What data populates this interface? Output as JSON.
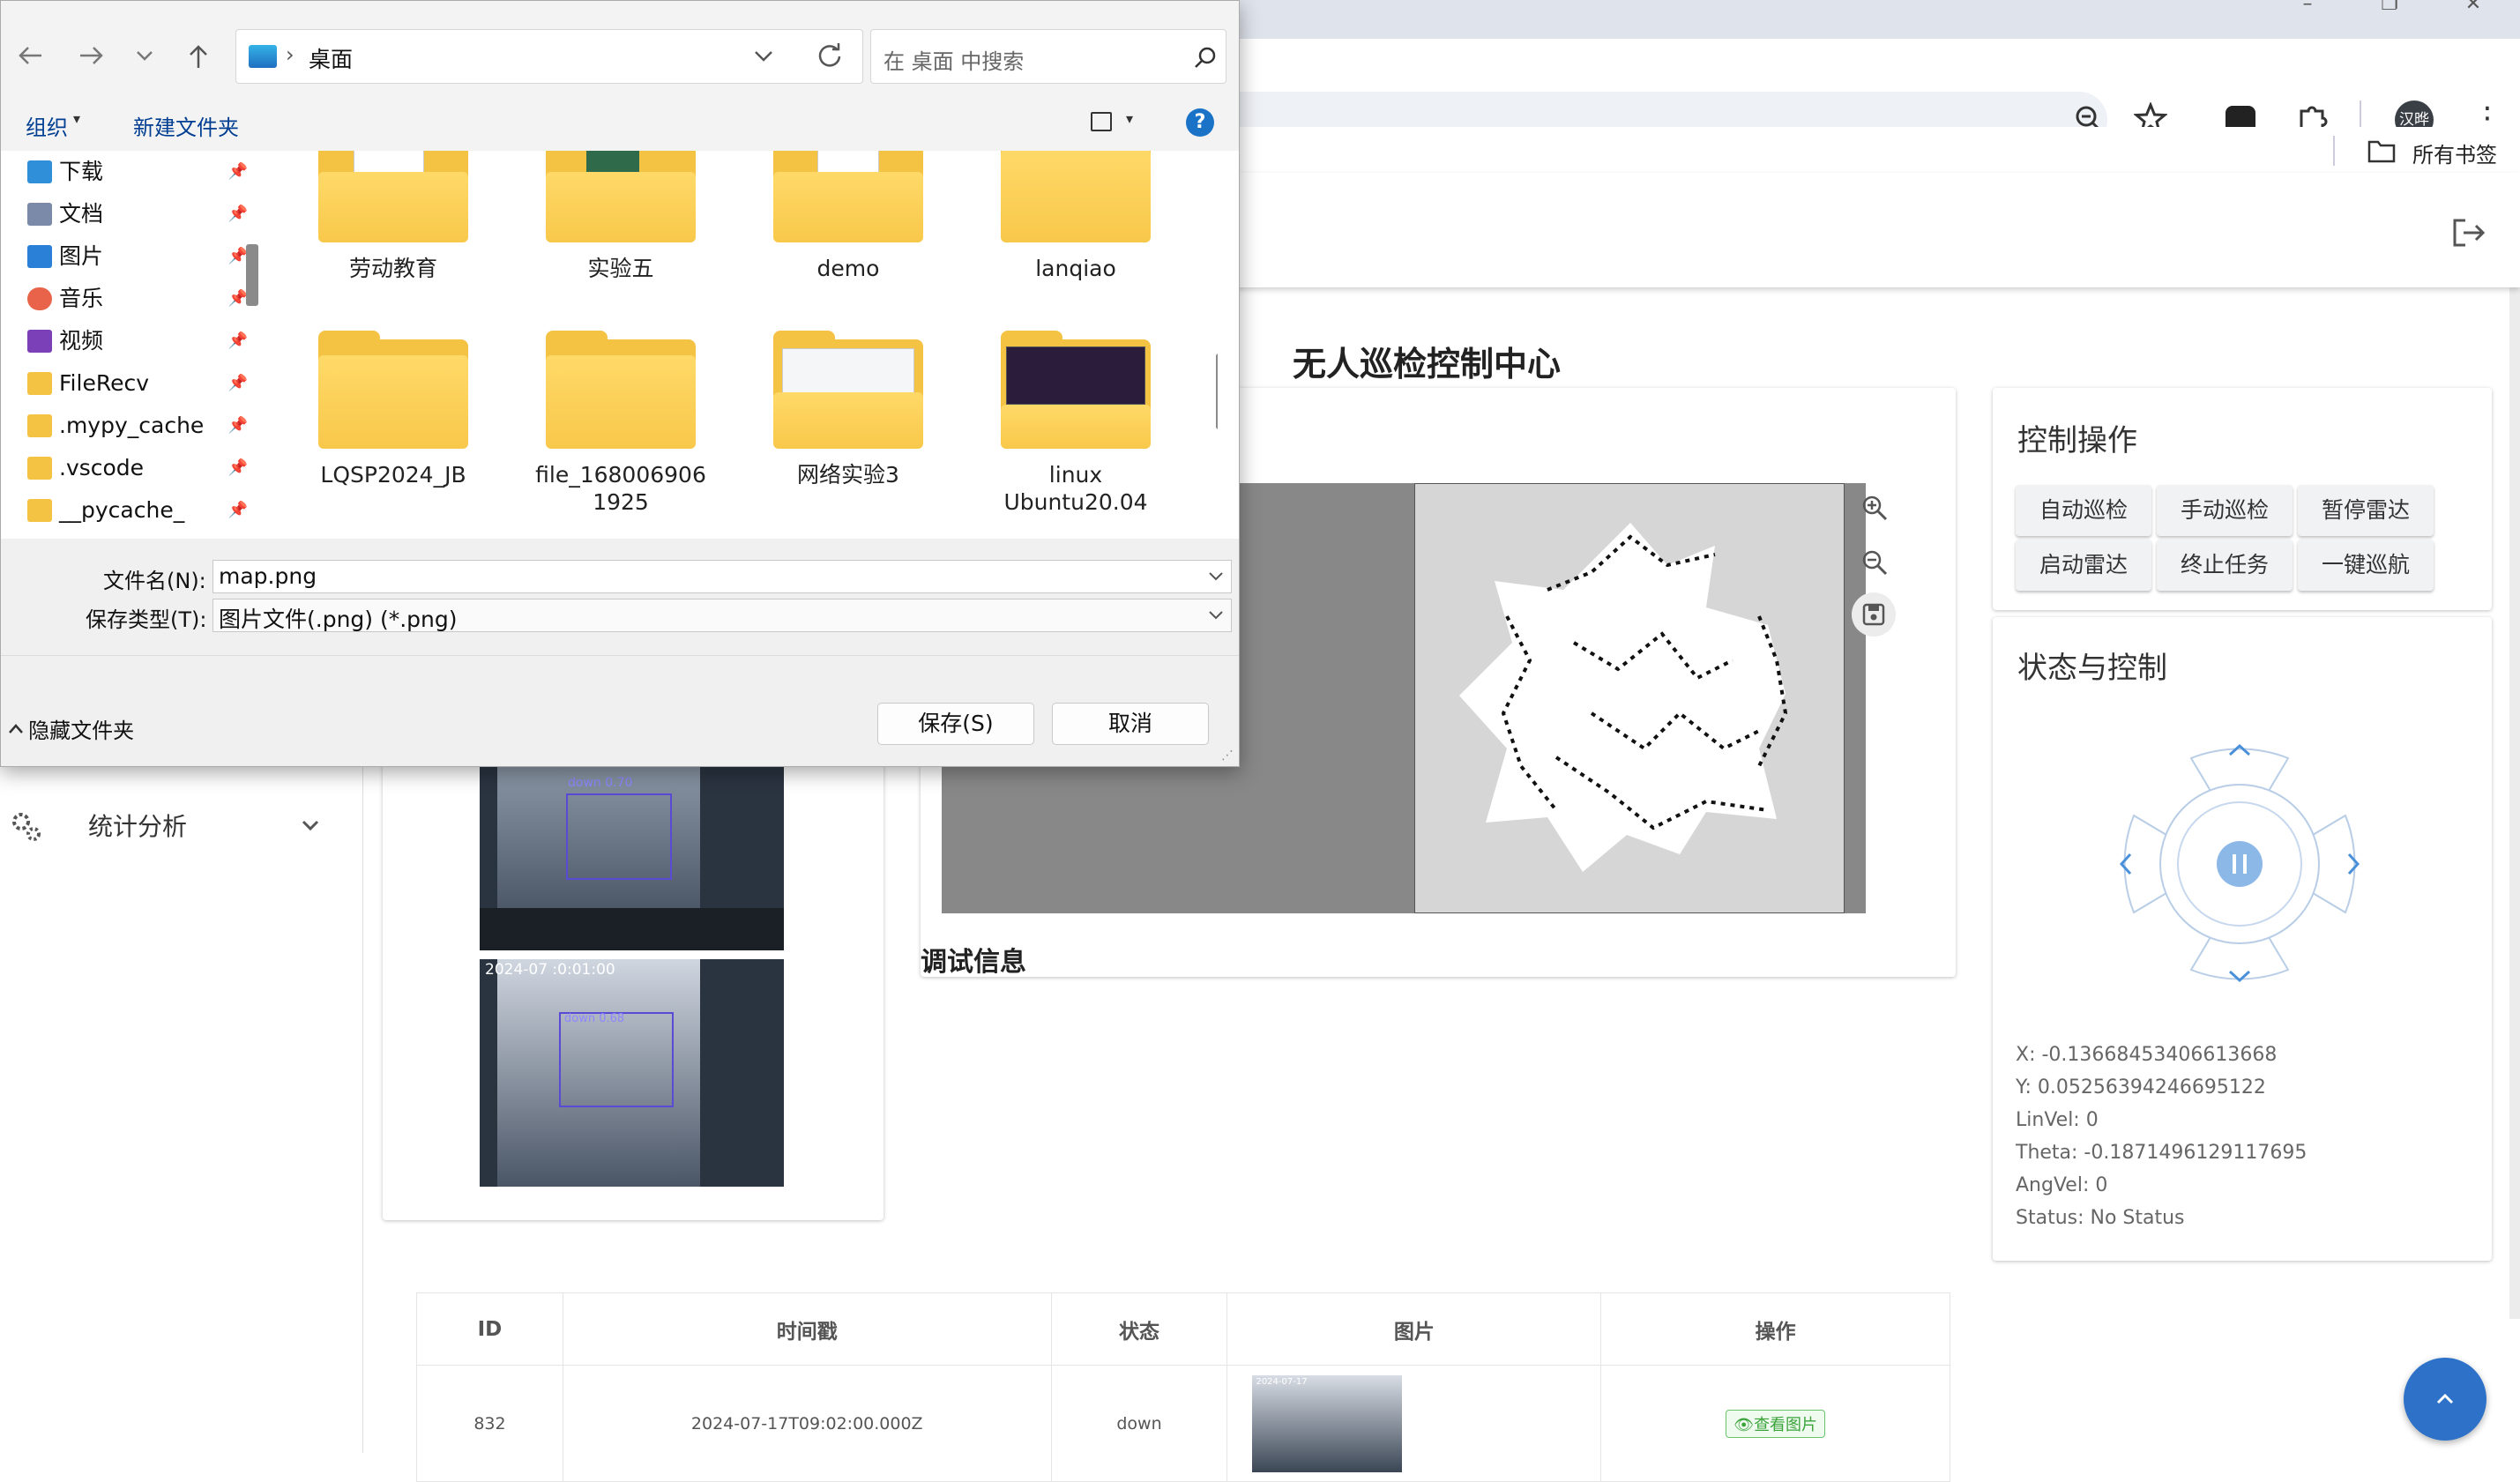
{
  "browser": {
    "avatar": "汉晔",
    "bookmarks_all": "所有书签",
    "window_controls": [
      "–",
      "❐",
      "✕"
    ]
  },
  "app": {
    "title": "无人巡检控制中心",
    "sidebar": {
      "stats_label": "统计分析"
    },
    "map": {
      "zoom_in": "zoom-in-icon",
      "zoom_out": "zoom-out-icon",
      "save": "save-icon"
    },
    "debug_title": "调试信息",
    "control_panel": {
      "title": "控制操作",
      "buttons": [
        "自动巡检",
        "手动巡检",
        "暂停雷达",
        "启动雷达",
        "终止任务",
        "一键巡航"
      ]
    },
    "status_panel": {
      "title": "状态与控制",
      "lines": [
        "X: -0.13668453406613668",
        "Y: 0.05256394246695122",
        "LinVel: 0",
        "Theta: -0.1871496129117695",
        "AngVel: 0",
        "Status: No Status"
      ]
    },
    "camera": {
      "frames": [
        {
          "label": "down 0.70"
        },
        {
          "timestamp": "2024-07  :0:01:00",
          "label": "down 0.68"
        }
      ]
    },
    "table": {
      "headers": [
        "ID",
        "时间戳",
        "状态",
        "图片",
        "操作"
      ],
      "rows": [
        {
          "id": "832",
          "timestamp": "2024-07-17T09:02:00.000Z",
          "status": "down",
          "thumb_caption": "2024-07-17",
          "action": "查看图片"
        }
      ]
    }
  },
  "dialog": {
    "breadcrumb": "桌面",
    "search_placeholder": "在 桌面 中搜索",
    "organize": "组织",
    "new_folder": "新建文件夹",
    "nav": [
      {
        "label": "下载",
        "color": "#2f8fd8"
      },
      {
        "label": "文档",
        "color": "#7a8aa8"
      },
      {
        "label": "图片",
        "color": "#2a7fd6"
      },
      {
        "label": "音乐",
        "color": "#e8634a"
      },
      {
        "label": "视频",
        "color": "#7b3fb7"
      },
      {
        "label": "FileRecv",
        "color": "#f5c343"
      },
      {
        "label": ".mypy_cache",
        "color": "#f5c343"
      },
      {
        "label": ".vscode",
        "color": "#f5c343"
      },
      {
        "label": "__pycache_",
        "color": "#f5c343"
      }
    ],
    "folders_row1": [
      "劳动教育",
      "实验五",
      "demo",
      "lanqiao"
    ],
    "folders_row2": [
      "LQSP2024_JB",
      "file_168006906\n1925",
      "网络实验3",
      "linux\nUbuntu20.04"
    ],
    "filename_label": "文件名(N):",
    "filename_value": "map.png",
    "filetype_label": "保存类型(T):",
    "filetype_value": "图片文件(.png) (*.png)",
    "hide_folders": "隐藏文件夹",
    "save": "保存(S)",
    "cancel": "取消"
  }
}
